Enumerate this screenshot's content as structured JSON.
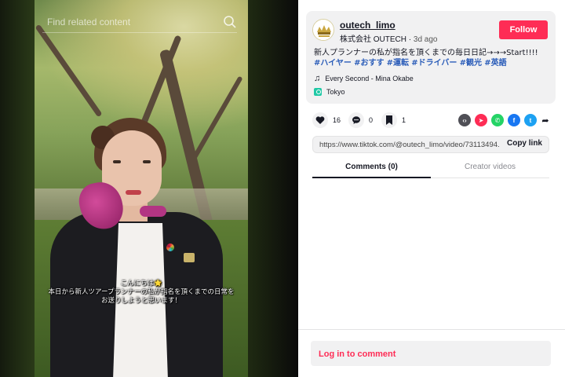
{
  "video": {
    "search_placeholder": "Find related content",
    "caption_lines": [
      "こんにちは🌟",
      "本日から新人ツアープランナーの私が指名を頂くまでの日常を",
      "お送りしようと思います！"
    ]
  },
  "post": {
    "author": {
      "username": "outech_limo",
      "display_name": "株式会社 OUTECH",
      "separator": "·",
      "posted_ago": "3d ago"
    },
    "follow_label": "Follow",
    "description_text": "新人プランナーの私が指名を頂くまでの毎日日記→→→Start!!!!",
    "hashtags": [
      "#ハイヤー",
      "#おすす",
      "#運転",
      "#ドライバー",
      "#観光",
      "#英語"
    ],
    "music": "Every Second - Mina Okabe",
    "location": "Tokyo"
  },
  "actions": {
    "likes": "16",
    "comments": "0",
    "saves": "1",
    "share_icons": [
      "embed-icon",
      "send-icon",
      "whatsapp-icon",
      "facebook-icon",
      "twitter-icon",
      "share-arrow-icon"
    ]
  },
  "link": {
    "url": "https://www.tiktok.com/@outech_limo/video/73113494...",
    "copy_label": "Copy link"
  },
  "tabs": {
    "comments": "Comments (0)",
    "creator": "Creator videos"
  },
  "login_prompt": "Log in to comment",
  "colors": {
    "accent": "#fe2c55",
    "hashtag": "#2b5db9",
    "panel_bg": "#f1f1f2",
    "text": "#161823"
  }
}
